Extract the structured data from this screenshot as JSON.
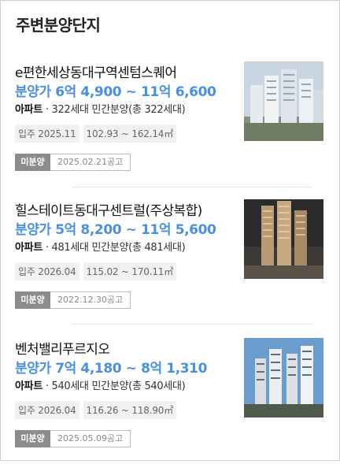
{
  "panel": {
    "title": "주변분양단지"
  },
  "items": [
    {
      "name": "e편한세상동대구역센텀스퀘어",
      "price": "분양가 6억 4,900 ~ 11억 6,600",
      "type": "아파트",
      "info": " · 322세대 민간분양(총 322세대)",
      "move_in": "입주 2025.11",
      "area": "102.93 ~ 162.14㎡",
      "status": "미분양",
      "notice_date": "2025.02.21공고",
      "image_icon": "apartment-photo"
    },
    {
      "name": "힐스테이트동대구센트럴(주상복합)",
      "price": "분양가 5억 8,200 ~ 11억 5,600",
      "type": "아파트",
      "info": " · 481세대 민간분양(총 481세대)",
      "move_in": "입주 2026.04",
      "area": "115.02 ~ 170.11㎡",
      "status": "미분양",
      "notice_date": "2022.12.30공고",
      "image_icon": "apartment-photo"
    },
    {
      "name": "벤처밸리푸르지오",
      "price": "분양가 7억 4,180 ~ 8억 1,310",
      "type": "아파트",
      "info": " · 540세대 민간분양(총 540세대)",
      "move_in": "입주 2026.04",
      "area": "116.26 ~ 118.90㎡",
      "status": "미분양",
      "notice_date": "2025.05.09공고",
      "image_icon": "apartment-photo"
    }
  ],
  "colors": {
    "price": "#4a90e2",
    "status_badge": "#8c8c8c",
    "tag_bg": "#f1f1f1"
  }
}
